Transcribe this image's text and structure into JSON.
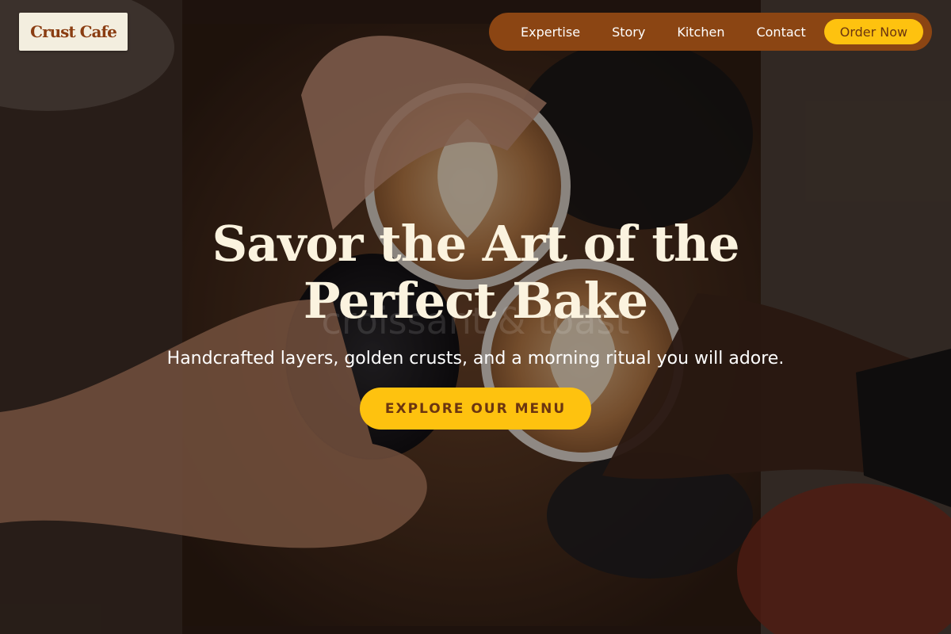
{
  "brand": {
    "logo_text": "Crust Cafe"
  },
  "nav": {
    "links": [
      {
        "label": "Expertise"
      },
      {
        "label": "Story"
      },
      {
        "label": "Kitchen"
      },
      {
        "label": "Contact"
      }
    ],
    "cta_label": "Order Now"
  },
  "hero": {
    "headline_line1": "Savor the Art of the",
    "headline_line2": "Perfect Bake",
    "ghost_text": "croissant & toast",
    "subheadline": "Handcrafted layers, golden crusts, and a morning ritual you will adore.",
    "cta_label": "EXPLORE OUR MENU"
  },
  "colors": {
    "brand_brown": "#8b4513",
    "accent_yellow": "#fec20f",
    "logo_bg": "#f3eedf",
    "headline_cream": "#fbf3df"
  }
}
